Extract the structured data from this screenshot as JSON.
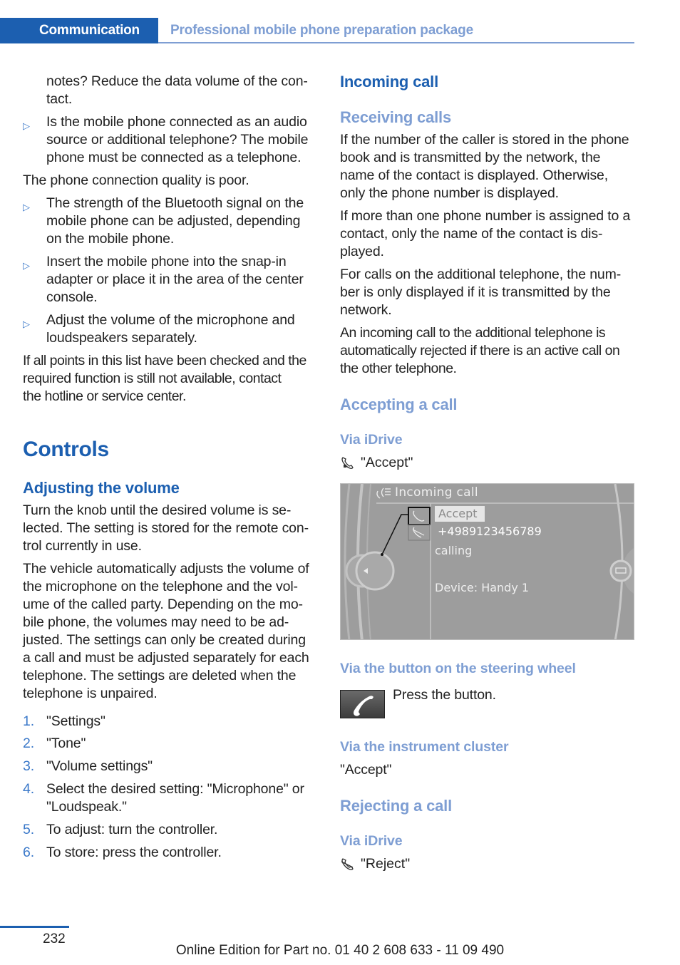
{
  "header": {
    "section": "Communication",
    "subsection": "Professional mobile phone preparation package"
  },
  "left": {
    "cont_text": [
      "notes? Reduce the data volume of the con-",
      "tact."
    ],
    "bullet_a": [
      "Is the mobile phone connected as an audio",
      "source or additional telephone? The mobile",
      "phone must be connected as a telephone."
    ],
    "para_quality": "The phone connection quality is poor.",
    "bullet_b": [
      "The strength of the Bluetooth signal on the",
      "mobile phone can be adjusted, depending",
      "on the mobile phone."
    ],
    "bullet_c": [
      "Insert the mobile phone into the snap-in",
      "adapter or place it in the area of the center",
      "console."
    ],
    "bullet_d": [
      "Adjust the volume of the microphone and",
      "loudspeakers separately."
    ],
    "para_hotline": [
      "If all points in this list have been checked and the",
      "required function is still not available, contact",
      "the hotline or service center."
    ],
    "bullet_marker": "▷",
    "controls_title": "Controls",
    "volume_title": "Adjusting the volume",
    "volume_p1": [
      "Turn the knob until the desired volume is se-",
      "lected. The setting is stored for the remote con-",
      "trol currently in use."
    ],
    "volume_p2": [
      "The vehicle automatically adjusts the volume of",
      "the microphone on the telephone and the vol-",
      "ume of the called party. Depending on the mo-",
      "bile phone, the volumes may need to be ad-",
      "justed. The settings can only be created during",
      "a call and must be adjusted separately for each",
      "telephone. The settings are deleted when the",
      "telephone is unpaired."
    ],
    "steps": [
      {
        "num": "1.",
        "lines": [
          "\"Settings\""
        ]
      },
      {
        "num": "2.",
        "lines": [
          "\"Tone\""
        ]
      },
      {
        "num": "3.",
        "lines": [
          "\"Volume settings\""
        ]
      },
      {
        "num": "4.",
        "lines": [
          "Select the desired setting: \"Microphone\" or",
          "\"Loudspeak.\""
        ]
      },
      {
        "num": "5.",
        "lines": [
          "To adjust: turn the controller."
        ]
      },
      {
        "num": "6.",
        "lines": [
          "To store: press the controller."
        ]
      }
    ]
  },
  "right": {
    "incoming_title": "Incoming call",
    "receiving_title": "Receiving calls",
    "recv_p1": [
      "If the number of the caller is stored in the phone",
      "book and is transmitted by the network, the",
      "name of the contact is displayed. Otherwise,",
      "only the phone number is displayed."
    ],
    "recv_p2": [
      "If more than one phone number is assigned to a",
      "contact, only the name of the contact is dis-",
      "played."
    ],
    "recv_p3": [
      "For calls on the additional telephone, the num-",
      "ber is only displayed if it is transmitted by the",
      "network."
    ],
    "recv_p4": [
      "An incoming call to the additional telephone is",
      "automatically rejected if there is an active call on",
      "the other telephone."
    ],
    "accepting_title": "Accepting a call",
    "via_idrive": "Via iDrive",
    "accept_label": "\"Accept\"",
    "screen": {
      "title": "Incoming call",
      "accept_button": "Accept",
      "number": "+4989123456789",
      "status": "calling",
      "device": "Device: Handy 1"
    },
    "via_wheel": "Via the button on the steering wheel",
    "press_button": "Press the button.",
    "via_cluster": "Via the instrument cluster",
    "cluster_accept": "\"Accept\"",
    "rejecting_title": "Rejecting a call",
    "via_idrive_2": "Via iDrive",
    "reject_label": "\"Reject\""
  },
  "footer": {
    "page_number": "232",
    "edition": "Online Edition for Part no. 01 40 2 608 633 - 11 09 490"
  }
}
